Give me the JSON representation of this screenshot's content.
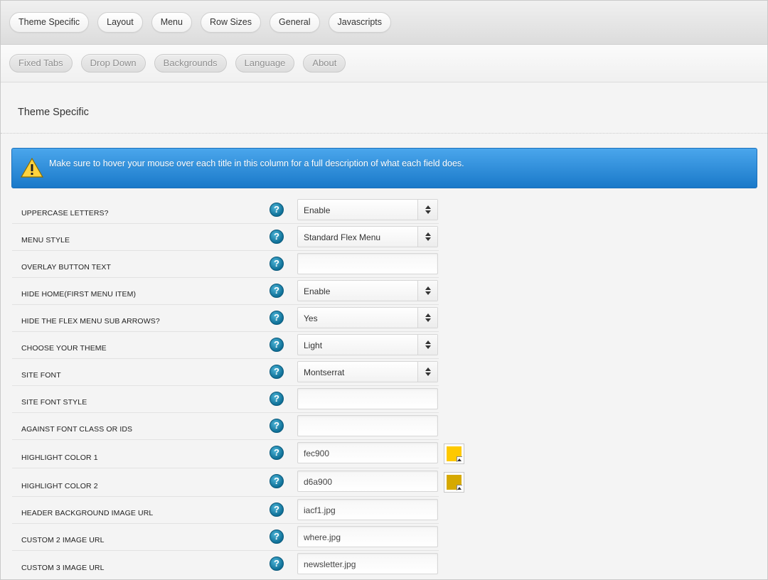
{
  "tabs_primary": [
    "Theme Specific",
    "Layout",
    "Menu",
    "Row Sizes",
    "General",
    "Javascripts"
  ],
  "tabs_secondary": [
    "Fixed Tabs",
    "Drop Down",
    "Backgrounds",
    "Language",
    "About"
  ],
  "section_title": "Theme Specific",
  "notice": {
    "icon": "warning-icon",
    "text": "Make sure to hover your mouse over each title in this column for a full description of what each field does."
  },
  "help_glyph": "?",
  "fields": [
    {
      "label": "UPPERCASE LETTERS?",
      "type": "select",
      "value": "Enable"
    },
    {
      "label": "MENU STYLE",
      "type": "select",
      "value": "Standard Flex Menu"
    },
    {
      "label": "OVERLAY BUTTON TEXT",
      "type": "input",
      "value": ""
    },
    {
      "label": "HIDE HOME(FIRST MENU ITEM)",
      "type": "select",
      "value": "Enable"
    },
    {
      "label": "HIDE THE FLEX MENU SUB ARROWS?",
      "type": "select",
      "value": "Yes"
    },
    {
      "label": "CHOOSE YOUR THEME",
      "type": "select",
      "value": "Light"
    },
    {
      "label": "SITE FONT",
      "type": "select",
      "value": "Montserrat"
    },
    {
      "label": "SITE FONT STYLE",
      "type": "input",
      "value": ""
    },
    {
      "label": "AGAINST FONT CLASS OR IDS",
      "type": "input",
      "value": ""
    },
    {
      "label": "HIGHLIGHT COLOR 1",
      "type": "color",
      "value": "fec900",
      "color": "#fec900"
    },
    {
      "label": "HIGHLIGHT COLOR 2",
      "type": "color",
      "value": "d6a900",
      "color": "#d6a900"
    },
    {
      "label": "HEADER BACKGROUND IMAGE URL",
      "type": "input",
      "value": "iacf1.jpg"
    },
    {
      "label": "CUSTOM 2 IMAGE URL",
      "type": "input",
      "value": "where.jpg"
    },
    {
      "label": "CUSTOM 3 IMAGE URL",
      "type": "input",
      "value": "newsletter.jpg"
    }
  ]
}
